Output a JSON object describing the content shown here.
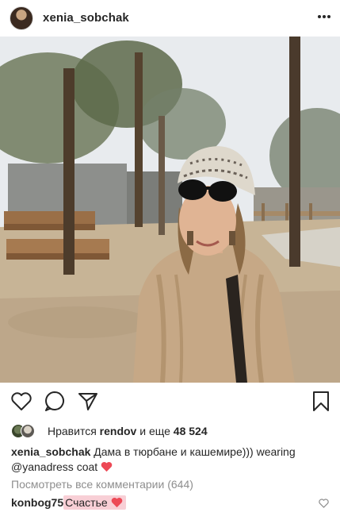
{
  "post": {
    "username": "xenia_sobchak",
    "more_icon": "ellipsis-icon"
  },
  "actions": {
    "like_icon": "heart-outline-icon",
    "comment_icon": "comment-bubble-icon",
    "share_icon": "paper-plane-icon",
    "save_icon": "bookmark-icon"
  },
  "likes": {
    "prefix": "Нравится",
    "user": "rendov",
    "middle": "и еще",
    "count": "48 524"
  },
  "caption": {
    "username": "xenia_sobchak",
    "text": "Дама в тюрбане и кашемире))) wearing",
    "mention": "@yanadress",
    "tail": "coat",
    "emoji": "red-heart"
  },
  "comments_link": "Посмотреть все комментарии (644)",
  "comment": {
    "username": "konbog75",
    "text": "Счастье",
    "emoji": "red-heart",
    "like_icon": "small-heart-outline-icon"
  },
  "colors": {
    "text": "#262626",
    "muted": "#8e8e8e",
    "heart": "#ed4956",
    "highlight": "#f8cfd6"
  }
}
